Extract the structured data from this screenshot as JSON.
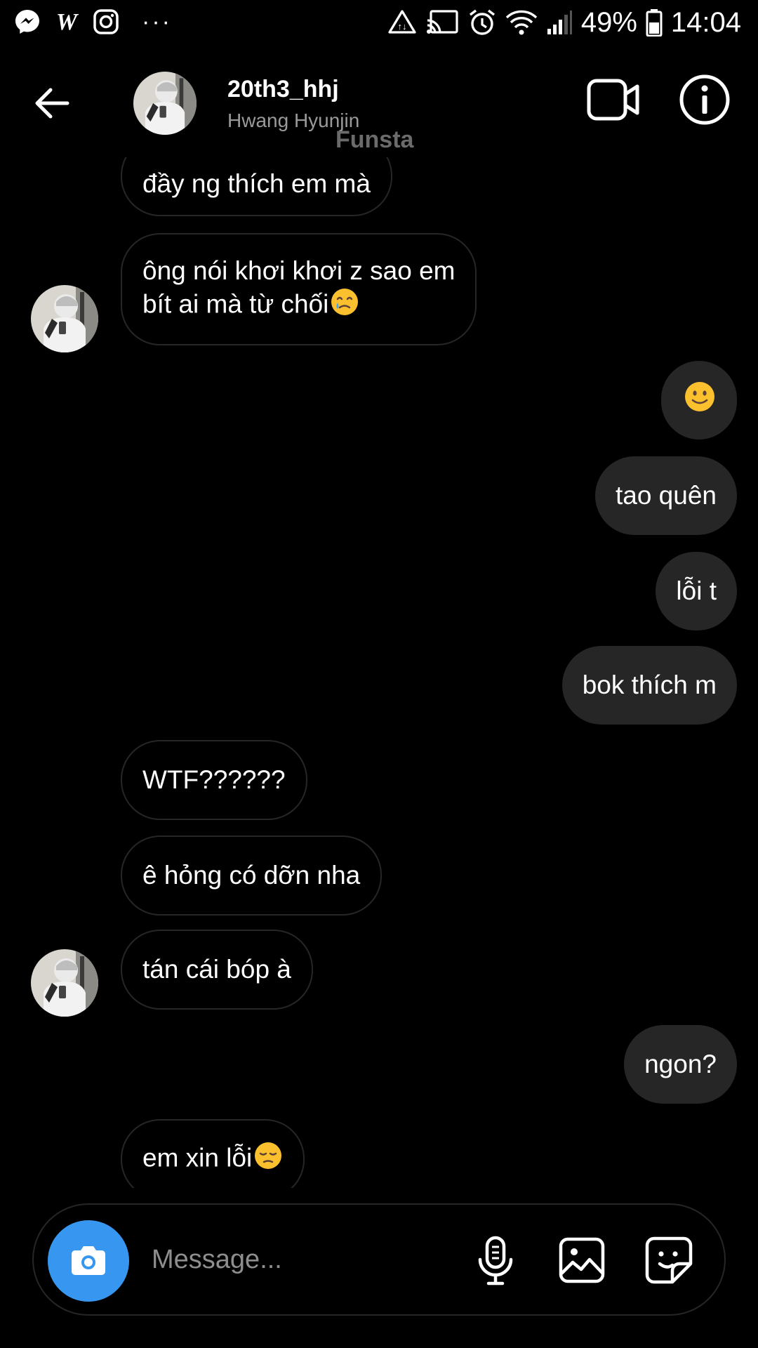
{
  "status_bar": {
    "left_icons": [
      "messenger-icon",
      "w-icon",
      "instagram-icon"
    ],
    "more": "···",
    "right_icons": [
      "data-saver-icon",
      "cast-icon",
      "alarm-icon",
      "wifi-icon",
      "signal-icon",
      "battery-icon"
    ],
    "battery": "49%",
    "time": "14:04"
  },
  "header": {
    "username": "20th3_hhj",
    "display_name": "Hwang Hyunjin",
    "tag": "Funsta"
  },
  "messages": [
    {
      "dir": "in",
      "lines": [
        "đầy ng thích em mà"
      ]
    },
    {
      "dir": "in",
      "lines": [
        "ông nói khơi khơi z sao em",
        "bít ai mà từ chối"
      ],
      "emoji": "smiling-tear-emoji"
    },
    {
      "dir": "out",
      "emoji": "slightly-smiling-emoji"
    },
    {
      "dir": "out",
      "lines": [
        "tao quên"
      ]
    },
    {
      "dir": "out",
      "lines": [
        "lỗi t"
      ]
    },
    {
      "dir": "out",
      "lines": [
        "bok thích m"
      ]
    },
    {
      "dir": "in",
      "lines": [
        "WTF??????"
      ]
    },
    {
      "dir": "in",
      "lines": [
        "ê hỏng có dỡn nha"
      ]
    },
    {
      "dir": "in",
      "lines": [
        "tán cái bóp à"
      ]
    },
    {
      "dir": "out",
      "lines": [
        "ngon?"
      ]
    },
    {
      "dir": "in",
      "lines": [
        "em xin lỗi"
      ],
      "emoji": "pensive-face-emoji"
    }
  ],
  "composer": {
    "placeholder": "Message...",
    "accent": "#3797f0"
  },
  "colors": {
    "background": "#000000",
    "outgoing_bubble": "#262626",
    "incoming_border": "#262626",
    "secondary_text": "#9a9a9a"
  }
}
